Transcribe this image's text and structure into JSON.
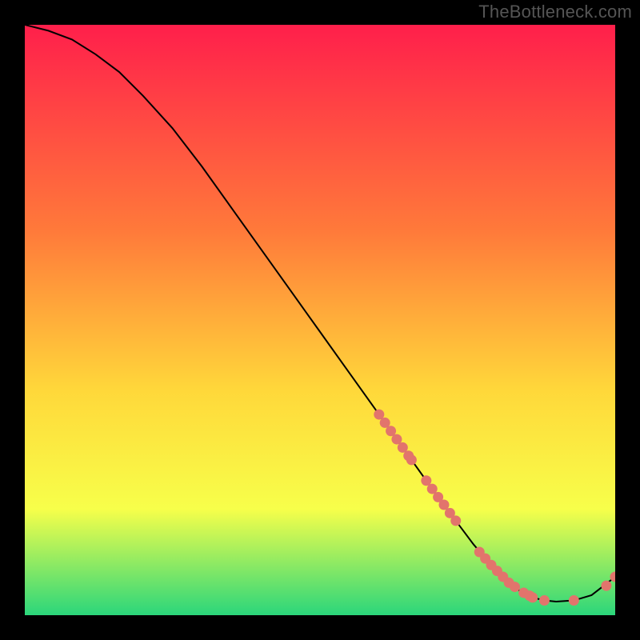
{
  "watermark": "TheBottleneck.com",
  "colors": {
    "gradient_top": "#ff1f4b",
    "gradient_mid1": "#ff7a3a",
    "gradient_mid2": "#ffd83a",
    "gradient_mid3": "#f7ff4a",
    "gradient_bottom": "#2bd67b",
    "curve": "#000000",
    "marker": "#e2746c",
    "frame": "#000000"
  },
  "chart_data": {
    "type": "line",
    "title": "",
    "xlabel": "",
    "ylabel": "",
    "xlim": [
      0,
      100
    ],
    "ylim": [
      0,
      100
    ],
    "x": [
      0,
      4,
      8,
      12,
      16,
      20,
      25,
      30,
      35,
      40,
      45,
      50,
      55,
      60,
      65,
      70,
      73,
      76,
      79,
      82,
      84,
      86,
      88,
      90,
      93,
      96,
      100
    ],
    "values": [
      100,
      99,
      97.5,
      95,
      92,
      88,
      82.5,
      76,
      69,
      62,
      55,
      48,
      41,
      34,
      27,
      20,
      16,
      12,
      8.5,
      5.5,
      4,
      3,
      2.5,
      2.3,
      2.5,
      3.4,
      6.5
    ],
    "markers_x": [
      60,
      61,
      62,
      63,
      64,
      65,
      65.5,
      68,
      69,
      70,
      71,
      72,
      73,
      77,
      78,
      79,
      80,
      81,
      82,
      83,
      84.5,
      85.5,
      86,
      88,
      93,
      98.5,
      100
    ],
    "markers_y": [
      34,
      32.6,
      31.2,
      29.8,
      28.4,
      27,
      26.3,
      22.8,
      21.4,
      20,
      18.7,
      17.3,
      16,
      10.7,
      9.6,
      8.5,
      7.5,
      6.5,
      5.5,
      4.8,
      3.8,
      3.3,
      3,
      2.5,
      2.5,
      5,
      6.5
    ]
  }
}
